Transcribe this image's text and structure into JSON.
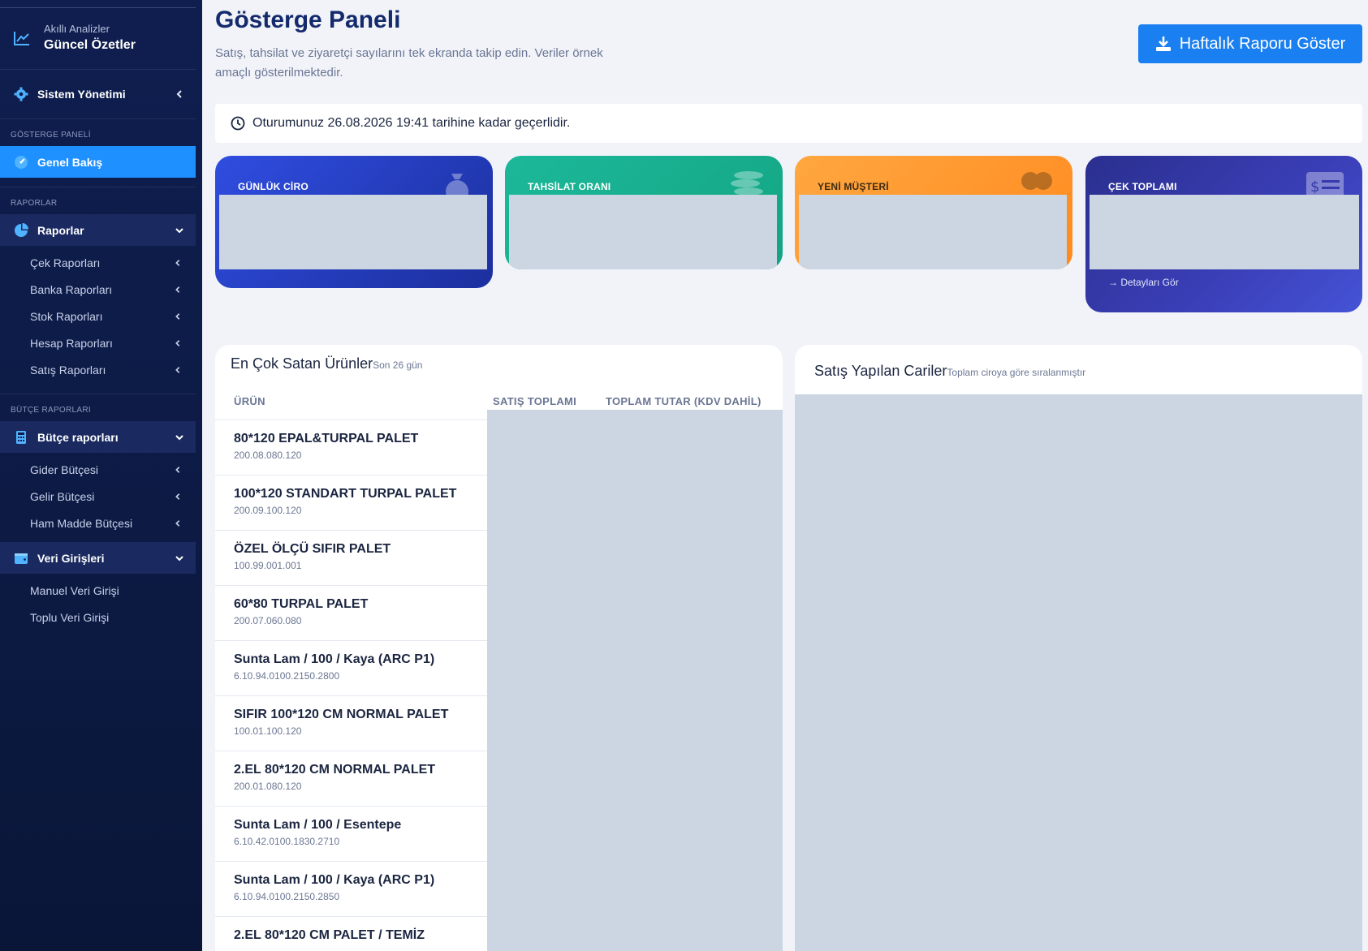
{
  "sidebar": {
    "brand_sub": "Akıllı Analizler",
    "brand_title": "Güncel Özetler",
    "system_label": "Sistem Yönetimi",
    "section_dashboard": "GÖSTERGE PANELİ",
    "overview_label": "Genel Bakış",
    "section_reports": "RAPORLAR",
    "reports_label": "Raporlar",
    "report_items": [
      "Çek Raporları",
      "Banka Raporları",
      "Stok Raporları",
      "Hesap Raporları",
      "Satış Raporları"
    ],
    "section_budget": "BÜTÇE RAPORLARI",
    "budget_label": "Bütçe raporları",
    "budget_items": [
      "Gider Bütçesi",
      "Gelir Bütçesi",
      "Ham Madde Bütçesi"
    ],
    "data_entry_label": "Veri Girişleri",
    "data_entry_items": [
      "Manuel Veri Girişi",
      "Toplu Veri Girişi"
    ]
  },
  "header": {
    "title": "Gösterge Paneli",
    "description": "Satış, tahsilat ve ziyaretçi sayılarını tek ekranda takip edin. Veriler örnek amaçlı gösterilmektedir.",
    "report_button": "Haftalık Raporu Göster"
  },
  "session": {
    "text": "Oturumunuz 26.08.2026 19:41 tarihine kadar geçerlidir."
  },
  "kpis": [
    {
      "label": "GÜNLÜK CİRO",
      "color": "#2f4de0"
    },
    {
      "label": "TAHSİLAT ORANI",
      "color": "#1cb89a"
    },
    {
      "label": "YENİ MÜŞTERİ",
      "color": "#ffa740"
    },
    {
      "label": "ÇEK TOPLAMI",
      "color": "#3b3fb8",
      "link": "→ Detayları Gör"
    }
  ],
  "top_products": {
    "title": "En Çok Satan Ürünler",
    "subtitle": "Son 26 gün",
    "columns": [
      "ÜRÜN",
      "SATIŞ TOPLAMI",
      "TOPLAM TUTAR (KDV DAHİL)"
    ],
    "rows": [
      {
        "name": "80*120 EPAL&TURPAL PALET",
        "code": "200.08.080.120"
      },
      {
        "name": "100*120 STANDART TURPAL PALET",
        "code": "200.09.100.120"
      },
      {
        "name": "ÖZEL ÖLÇÜ SIFIR PALET",
        "code": "100.99.001.001"
      },
      {
        "name": "60*80 TURPAL PALET",
        "code": "200.07.060.080"
      },
      {
        "name": "Sunta Lam / 100 / Kaya (ARC P1)",
        "code": "6.10.94.0100.2150.2800"
      },
      {
        "name": "SIFIR 100*120 CM NORMAL PALET",
        "code": "100.01.100.120"
      },
      {
        "name": "2.EL 80*120 CM NORMAL PALET",
        "code": "200.01.080.120"
      },
      {
        "name": "Sunta Lam / 100 / Esentepe",
        "code": "6.10.42.0100.1830.2710"
      },
      {
        "name": "Sunta Lam / 100 / Kaya (ARC P1)",
        "code": "6.10.94.0100.2150.2850"
      },
      {
        "name": "2.EL 80*120 CM PALET / TEMİZ",
        "code": ""
      }
    ]
  },
  "customers": {
    "title": "Satış Yapılan Cariler",
    "subtitle": "Toplam ciroya göre sıralanmıştır"
  },
  "colors": {
    "accent": "#1e90ff",
    "sidebar_bg": "#0f1e4f",
    "title": "#142a6c"
  }
}
